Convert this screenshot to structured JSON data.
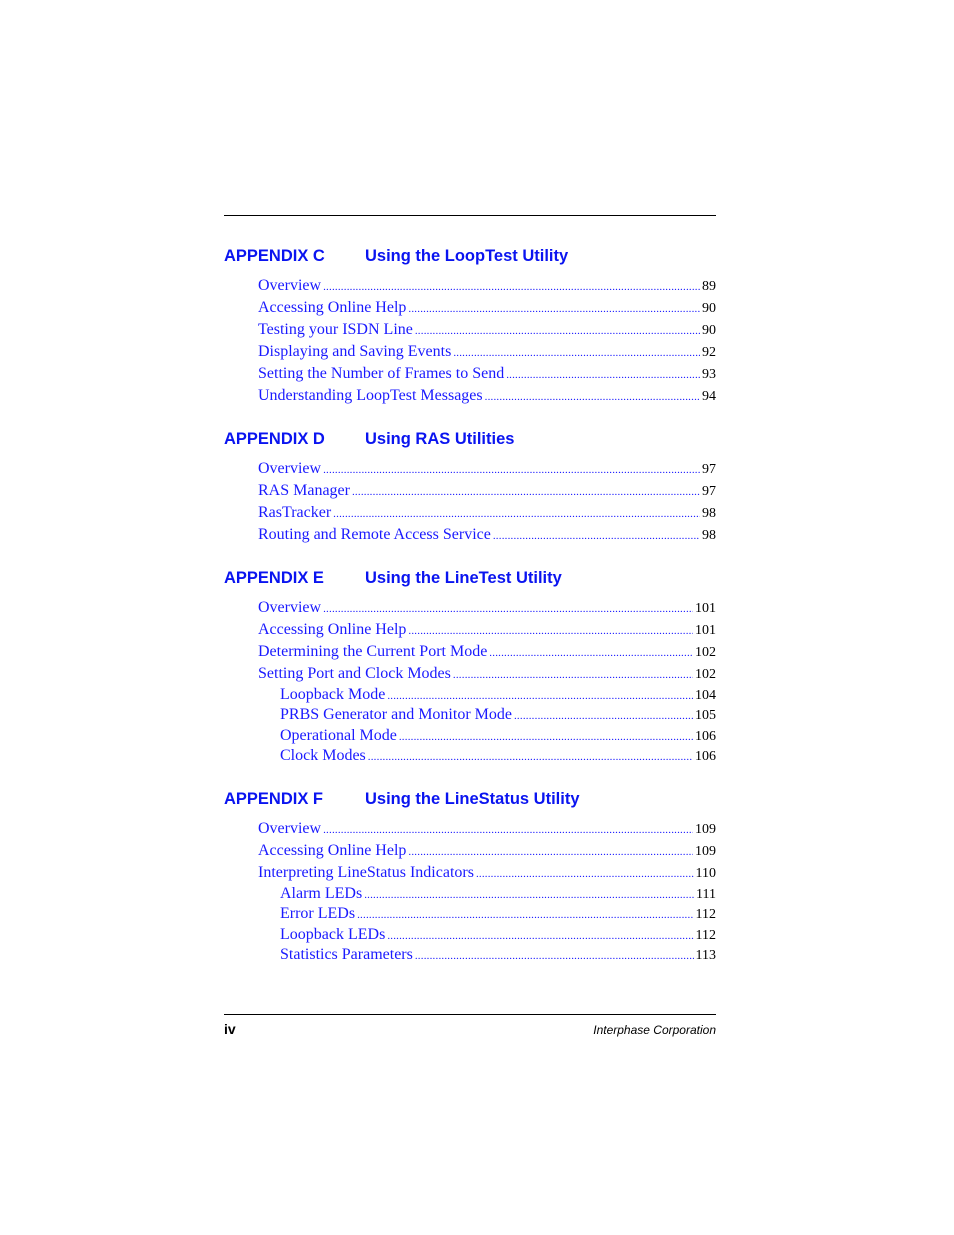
{
  "appendices": [
    {
      "label": "APPENDIX C",
      "title": "Using the LoopTest Utility",
      "entries": [
        {
          "text": "Overview",
          "page": "89",
          "level": 1
        },
        {
          "text": "Accessing Online Help",
          "page": "90",
          "level": 1
        },
        {
          "text": "Testing your ISDN Line",
          "page": "90",
          "level": 1
        },
        {
          "text": "Displaying and Saving Events",
          "page": "92",
          "level": 1
        },
        {
          "text": "Setting the Number of Frames to Send",
          "page": "93",
          "level": 1
        },
        {
          "text": "Understanding LoopTest Messages",
          "page": "94",
          "level": 1
        }
      ]
    },
    {
      "label": "APPENDIX D",
      "title": "Using RAS Utilities",
      "entries": [
        {
          "text": "Overview",
          "page": "97",
          "level": 1
        },
        {
          "text": "RAS Manager",
          "page": "97",
          "level": 1
        },
        {
          "text": "RasTracker",
          "page": "98",
          "level": 1
        },
        {
          "text": "Routing and Remote Access Service",
          "page": "98",
          "level": 1
        }
      ]
    },
    {
      "label": "APPENDIX E",
      "title": "Using the LineTest Utility",
      "entries": [
        {
          "text": "Overview",
          "page": "101",
          "level": 1
        },
        {
          "text": "Accessing Online Help",
          "page": "101",
          "level": 1
        },
        {
          "text": "Determining the Current Port Mode",
          "page": "102",
          "level": 1
        },
        {
          "text": "Setting Port and Clock Modes",
          "page": "102",
          "level": 1
        },
        {
          "text": "Loopback Mode",
          "page": "104",
          "level": 2
        },
        {
          "text": "PRBS Generator and Monitor Mode",
          "page": "105",
          "level": 2
        },
        {
          "text": "Operational Mode",
          "page": "106",
          "level": 2
        },
        {
          "text": "Clock Modes",
          "page": "106",
          "level": 2
        }
      ]
    },
    {
      "label": "APPENDIX F",
      "title": "Using the LineStatus Utility",
      "entries": [
        {
          "text": "Overview",
          "page": "109",
          "level": 1
        },
        {
          "text": "Accessing Online Help",
          "page": "109",
          "level": 1
        },
        {
          "text": "Interpreting LineStatus Indicators",
          "page": "110",
          "level": 1
        },
        {
          "text": "Alarm LEDs",
          "page": "111",
          "level": 2
        },
        {
          "text": "Error LEDs",
          "page": "112",
          "level": 2
        },
        {
          "text": "Loopback LEDs",
          "page": "112",
          "level": 2
        },
        {
          "text": "Statistics Parameters",
          "page": "113",
          "level": 2
        }
      ]
    }
  ],
  "footer": {
    "page_number": "iv",
    "company": "Interphase Corporation"
  },
  "colors": {
    "heading": "#0a14f0",
    "link": "#1a1aff"
  }
}
